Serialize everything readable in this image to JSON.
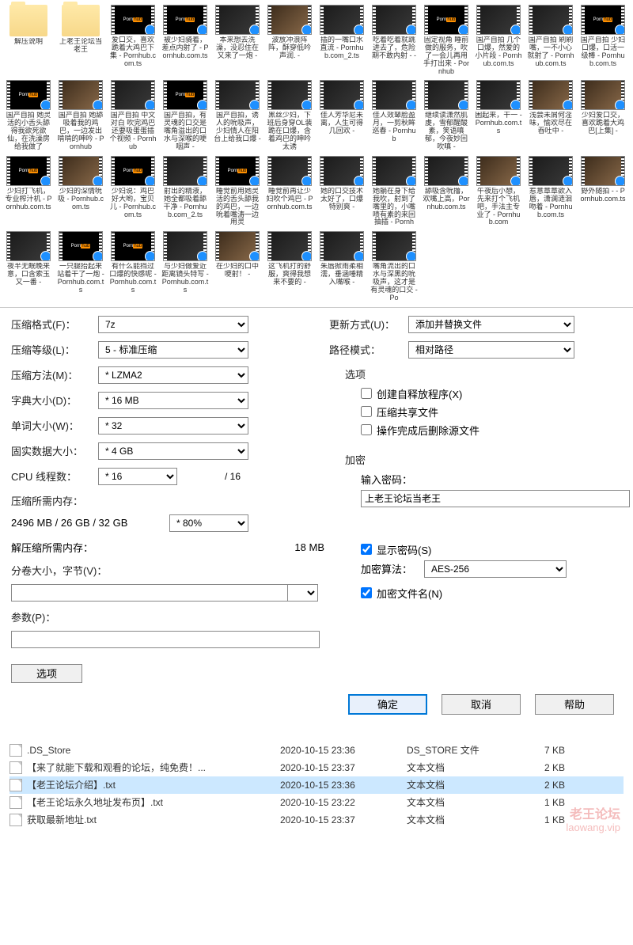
{
  "folders": [
    {
      "name": "解压说明"
    },
    {
      "name": "上老王论坛当老王"
    }
  ],
  "videos": [
    {
      "t": "ph",
      "label": "爱口交，喜欢跪着大鸡巴下集 - Pornhub.com.ts"
    },
    {
      "t": "ph",
      "label": "被少妇骑着，差点内射了 - Pornhub.com.ts"
    },
    {
      "t": "dark",
      "label": "本来想去洗澡，没忍住在又来了一炮 - "
    },
    {
      "t": "skin",
      "label": "波放冲浪阵阵，酥穿低吟声润. -"
    },
    {
      "t": "dark",
      "label": "插的一嘴口水直流 - Pornhub.com_2.ts"
    },
    {
      "t": "dark",
      "label": "吃着吃着就跳进去了，危险期不敢内射 - -"
    },
    {
      "t": "ph",
      "label": "固定视角 睡前做的服务，吹了一会儿再用手打出来 - Pornhub"
    },
    {
      "t": "dark",
      "label": "国产自拍 几个口爆，然爱的小片段 - Pornhub.com.ts"
    },
    {
      "t": "dark",
      "label": "国产自拍 刷刷嘴，一不小心就射了 - Pornhub.com.ts"
    },
    {
      "t": "ph",
      "label": "国产自拍 少妇口爆，口活一级棒 - Pornhub.com.ts"
    },
    {
      "t": "ph",
      "label": "国产自拍 她灵活的小舌头舔得我欲死欲仙，在洗澡房给我做了"
    },
    {
      "t": "skin",
      "label": "国产自拍 她舔吸着我的鸡巴，一边发出啃啃的呻吟 - Pornhub"
    },
    {
      "t": "dark",
      "label": "国产自拍 中文对白 吹完鸡巴还要吸蛋蛋插个视频 - Pornhub"
    },
    {
      "t": "ph",
      "label": "国产自拍，有灵魂的口交是嘴角溢出的口水与深喉的哽咽声 -"
    },
    {
      "t": "dark",
      "label": "国产自拍，诱人的吮吸声，少妇情人在阳台上给我口爆 -"
    },
    {
      "t": "dark",
      "label": "黑丝少妇，下班后身穿OL装跪在口爆，含着鸡巴的呻吟太诱"
    },
    {
      "t": "dark",
      "label": "佳人芳华尼未离，人生可得几回欢 - "
    },
    {
      "t": "dark",
      "label": "佳人效颦脸盈月，一剪秋眸巡春 - Pornhub"
    },
    {
      "t": "dark",
      "label": "继续读潇然肌虔，雪郁醒酸素，笑语嗔郁，今夜妙回吹嗔 -"
    },
    {
      "t": "dark",
      "label": "困起来，干一 - Pornhub.com.ts"
    },
    {
      "t": "skin",
      "label": "浅尝未屑何淫味，愉欢尽在吞吐中 - "
    },
    {
      "t": "skin",
      "label": "少妇爱口交，喜欢跪着大鸡巴[上集] - "
    },
    {
      "t": "ph",
      "label": "少妇打飞机，专业榨汁机 - Pornhub.com.ts"
    },
    {
      "t": "skin",
      "label": "少妇的深情吮吸 - Pornhub.com.ts"
    },
    {
      "t": "ph",
      "label": "少妇说：鸡巴好大哟，宝贝儿 - Pornhub.com.ts"
    },
    {
      "t": "dark",
      "label": "射出的精液，她全都吸着舔干净 - Pornhub.com_2.ts"
    },
    {
      "t": "ph",
      "label": "睡觉前用她灵活的舌头舔我的鸡巴，一边吮着嘴涛一边用灵"
    },
    {
      "t": "dark",
      "label": "睡觉前再让少妇吹个鸡巴 - Pornhub.com.ts"
    },
    {
      "t": "dark",
      "label": "她的口交技术太好了，口爆特别爽 -"
    },
    {
      "t": "dark",
      "label": "她躺在身下给我吹，射到了嘴里的，小嘴啧有素的来回抽插 - Pornh"
    },
    {
      "t": "dark",
      "label": "舔吸含吮撸，欢嘴上高，Pornhub.com.ts"
    },
    {
      "t": "skin",
      "label": "午夜后小憩，先来打个飞机吧，手法主专业了 - Pornhub.com"
    },
    {
      "t": "dark",
      "label": "惹意章章欲入唇，潇澜涟洄吻着 - Pornhub.com.ts"
    },
    {
      "t": "skin",
      "label": "野外随拍 - - Pornhub.com.ts"
    },
    {
      "t": "dark",
      "label": "夜半无眠晚来意，口含索玉又一番 - "
    },
    {
      "t": "ph",
      "label": "一只腿抬起来站着干了一炮 - Pornhub.com.ts"
    },
    {
      "t": "ph",
      "label": "有什么能挡过口爆的快感呢 - Pornhub.com.ts"
    },
    {
      "t": "dark",
      "label": "与少妇做爱近距离镜头特写 - Pornhub.com.ts"
    },
    {
      "t": "skin",
      "label": "在少妇的口中哽射！ - "
    },
    {
      "t": "dark",
      "label": "这飞机打的舒服，爽得我想来不要的 -"
    },
    {
      "t": "dark",
      "label": "朱唇掀雨柔相濡，垂涵唾精入嘴喉 - "
    },
    {
      "t": "dark",
      "label": "嘴角流出的口水与深黑的吮吸声，这才是有灵魂的口交 - Po"
    }
  ],
  "dialog": {
    "format_label": "压缩格式(F)：",
    "format_value": "7z",
    "level_label": "压缩等级(L)：",
    "level_value": "5 - 标准压缩",
    "method_label": "压缩方法(M)：",
    "method_value": "* LZMA2",
    "dict_label": "字典大小(D)：",
    "dict_value": "* 16 MB",
    "word_label": "单词大小(W)：",
    "word_value": "* 32",
    "solid_label": "固实数据大小：",
    "solid_value": "* 4 GB",
    "cpu_label": "CPU 线程数：",
    "cpu_value": "* 16",
    "cpu_total": "/ 16",
    "mem_compress_label": "压缩所需内存：",
    "mem_compress_value": "2496 MB / 26 GB / 32 GB",
    "mem_compress_pct": "* 80%",
    "mem_decompress_label": "解压缩所需内存：",
    "mem_decompress_value": "18 MB",
    "split_label": "分卷大小，字节(V)：",
    "param_label": "参数(P)：",
    "update_label": "更新方式(U)：",
    "update_value": "添加并替换文件",
    "path_label": "路径模式：",
    "path_value": "相对路径",
    "options_header": "选项",
    "opt_sfx": "创建自释放程序(X)",
    "opt_share": "压缩共享文件",
    "opt_delete": "操作完成后删除源文件",
    "encrypt_header": "加密",
    "password_label": "输入密码：",
    "password_value": "上老王论坛当老王",
    "show_pwd": "显示密码(S)",
    "enc_method_label": "加密算法：",
    "enc_method_value": "AES-256",
    "enc_names": "加密文件名(N)",
    "options_btn": "选项",
    "ok": "确定",
    "cancel": "取消",
    "help": "帮助"
  },
  "filelist": [
    {
      "name": ".DS_Store",
      "date": "2020-10-15 23:36",
      "type": "DS_STORE 文件",
      "size": "7 KB",
      "sel": false
    },
    {
      "name": "【来了就能下载和观看的论坛，纯免费！...",
      "date": "2020-10-15 23:37",
      "type": "文本文档",
      "size": "2 KB",
      "sel": false
    },
    {
      "name": "【老王论坛介绍】.txt",
      "date": "2020-10-15 23:36",
      "type": "文本文档",
      "size": "2 KB",
      "sel": true
    },
    {
      "name": "【老王论坛永久地址发布页】.txt",
      "date": "2020-10-15 23:22",
      "type": "文本文档",
      "size": "1 KB",
      "sel": false
    },
    {
      "name": "获取最新地址.txt",
      "date": "2020-10-15 23:37",
      "type": "文本文档",
      "size": "1 KB",
      "sel": false
    }
  ],
  "watermark": {
    "l1": "老王论坛",
    "l2": "laowang.vip"
  }
}
